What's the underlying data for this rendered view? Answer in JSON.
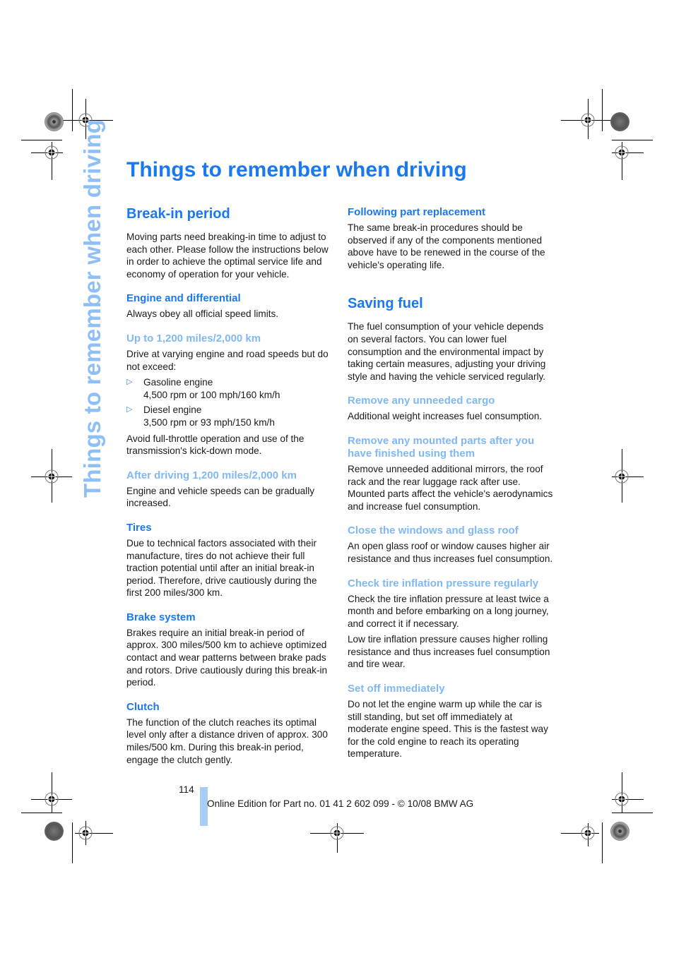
{
  "side_tab": {
    "label": "Things to remember when driving"
  },
  "page_title": "Things to remember when driving",
  "break_in": {
    "title": "Break-in period",
    "intro": "Moving parts need breaking-in time to adjust to each other. Please follow the instructions below in order to achieve the optimal service life and economy of operation for your vehicle.",
    "engine": {
      "title": "Engine and differential",
      "text": "Always obey all official speed limits."
    },
    "up_to": {
      "title": "Up to 1,200 miles/2,000 km",
      "text": "Drive at varying engine and road speeds but do not exceed:",
      "items": [
        {
          "line1": "Gasoline engine",
          "line2": "4,500 rpm or 100 mph/160 km/h"
        },
        {
          "line1": "Diesel engine",
          "line2": "3,500 rpm or 93 mph/150 km/h"
        }
      ],
      "note": "Avoid full-throttle operation and use of the transmission's kick-down mode."
    },
    "after": {
      "title": "After driving 1,200 miles/2,000 km",
      "text": "Engine and vehicle speeds can be gradually increased."
    },
    "tires": {
      "title": "Tires",
      "text": "Due to technical factors associated with their manufacture, tires do not achieve their full traction potential until after an initial break-in period. Therefore, drive cautiously during the first 200 miles/300 km."
    },
    "brakes": {
      "title": "Brake system",
      "text": "Brakes require an initial break-in period of approx. 300 miles/500 km to achieve optimized contact and wear patterns between brake pads and rotors. Drive cautiously during this break-in period."
    },
    "clutch": {
      "title": "Clutch",
      "text": "The function of the clutch reaches its optimal level only after a distance driven of approx. 300 miles/500 km. During this break-in period, engage the clutch gently."
    },
    "replacement": {
      "title": "Following part replacement",
      "text": "The same break-in procedures should be observed if any of the components mentioned above have to be renewed in the course of the vehicle's operating life."
    }
  },
  "saving_fuel": {
    "title": "Saving fuel",
    "intro": "The fuel consumption of your vehicle depends on several factors. You can lower fuel consumption and the environmental impact by taking certain measures, adjusting your driving style and having the vehicle serviced regularly.",
    "cargo": {
      "title": "Remove any unneeded cargo",
      "text": "Additional weight increases fuel consumption."
    },
    "mounted": {
      "title": "Remove any mounted parts after you have finished using them",
      "text": "Remove unneeded additional mirrors, the roof rack and the rear luggage rack after use. Mounted parts affect the vehicle's aerodynamics and increase fuel consumption."
    },
    "windows": {
      "title": "Close the windows and glass roof",
      "text": "An open glass roof or window causes higher air resistance and thus increases fuel consumption."
    },
    "tire_pressure": {
      "title": "Check tire inflation pressure regularly",
      "text1": "Check the tire inflation pressure at least twice a month and before embarking on a long journey, and correct it if necessary.",
      "text2": "Low tire inflation pressure causes higher rolling resistance and thus increases fuel consumption and tire wear."
    },
    "set_off": {
      "title": "Set off immediately",
      "text": "Do not let the engine warm up while the car is still standing, but set off immediately at moderate engine speed. This is the fastest way for the cold engine to reach its operating temperature."
    }
  },
  "footer": {
    "page_number": "114",
    "edition": "Online Edition for Part no. 01 41 2 602 099 - © 10/08 BMW AG"
  },
  "icons": {
    "bullet": "▷"
  },
  "colors": {
    "heading": "#1a78f0",
    "subheading_light": "#80b8f4",
    "side_tab": "#8ec0f7",
    "footer_bar": "#a9cdf7"
  }
}
